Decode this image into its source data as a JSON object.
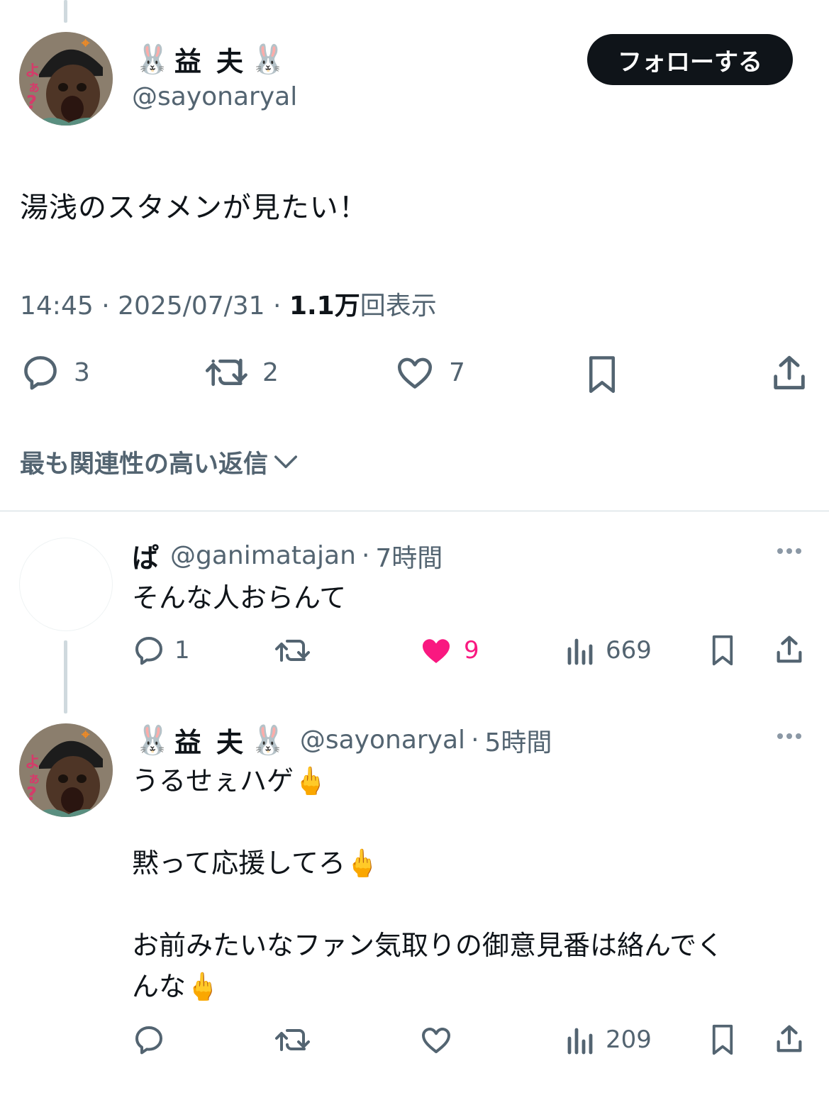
{
  "main_tweet": {
    "display_name": "益 夫",
    "name_emoji": "🐰",
    "handle": "@sayonaryal",
    "follow_label": "フォローする",
    "text": "湯浅のスタメンが見たい！",
    "time": "14:45",
    "date": "2025/07/31",
    "views_count": "1.1万",
    "views_label": "回表示",
    "replies": "3",
    "retweets": "2",
    "likes": "7"
  },
  "sort_label": "最も関連性の高い返信",
  "replies": [
    {
      "display_name": "ぱ",
      "handle": "@ganimatajan",
      "age": "7時間",
      "text": "そんな人おらんて",
      "reply_count": "1",
      "like_count": "9",
      "views": "669",
      "liked": true
    },
    {
      "display_name": "益 夫",
      "name_emoji": "🐰",
      "handle": "@sayonaryal",
      "age": "5時間",
      "line1": "うるせぇハゲ",
      "line2": "黙って応援してろ",
      "line3a": "お前みたいなファン気取りの御意見番は絡んでく",
      "line3b": "んな",
      "finger_emoji": "🖕",
      "views": "209"
    }
  ],
  "colors": {
    "text": "#0f1419",
    "secondary": "#536471",
    "like_pink": "#f91880",
    "divider": "#cfd9de"
  }
}
